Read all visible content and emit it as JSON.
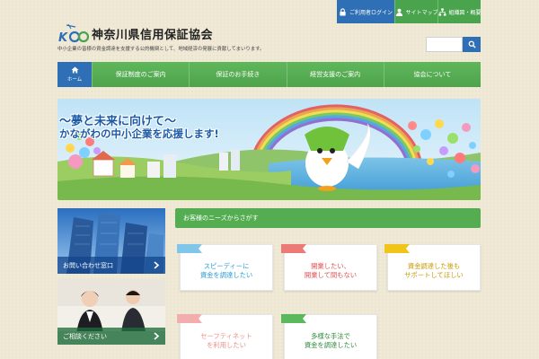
{
  "util_bar": {
    "login": "ご利用者ログイン",
    "sitemap": "サイトマップ",
    "org": "組織図・概要"
  },
  "header": {
    "logo_text": "神奈川県信用保証協会",
    "tagline": "中小企業の皆様の資金調達を支援する公的機関として、地域経済の発展に貢献してまいります。"
  },
  "search": {
    "placeholder": ""
  },
  "nav": {
    "home": "ホーム",
    "items": [
      "保証制度のご案内",
      "保証のお手続き",
      "経営支援のご案内",
      "協会について"
    ]
  },
  "banner": {
    "line1": "～夢と未来に向けて～",
    "line2": "かながわの中小企業を応援します!"
  },
  "side_cards": {
    "inquiry": "お問い合わせ窓口",
    "consult": "ご相談ください"
  },
  "section": {
    "title": "お客様のニーズからさがす"
  },
  "needs": [
    {
      "line1": "スピーディーに",
      "line2": "資金を調達したい",
      "color": "#2a9ad6"
    },
    {
      "line1": "開業したい、",
      "line2": "開業して間もない",
      "color": "#e0514e"
    },
    {
      "line1": "資金調達した後も",
      "line2": "サポートしてほしい",
      "color": "#e2b400"
    },
    {
      "line1": "セーフティネット",
      "line2": "を利用したい",
      "color": "#e8908e"
    },
    {
      "line1": "多様な手法で",
      "line2": "資金を調達したい",
      "color": "#2f8a3e"
    }
  ],
  "colors": {
    "primary_green": "#55ad52",
    "primary_blue": "#2f6fb5"
  }
}
